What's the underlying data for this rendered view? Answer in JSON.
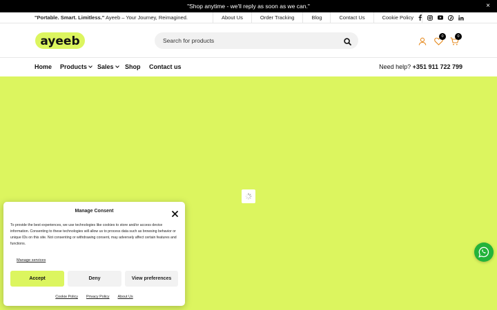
{
  "announcement": {
    "text": "\"Shop anytime - we'll reply as soon as we can.\"",
    "close_glyph": "×"
  },
  "utility": {
    "tagline_bold": "\"Portable. Smart. Limitless.\"",
    "tagline_rest": " Ayeeb – Your Journey, Reimagined.",
    "links": [
      "About Us",
      "Order Tracking",
      "Blog",
      "Contact Us",
      "Cookie Policy"
    ],
    "social_icons": [
      "facebook-icon",
      "instagram-icon",
      "youtube-icon",
      "pinterest-icon",
      "linkedin-icon"
    ]
  },
  "header": {
    "logo_text": "ayeeb",
    "search_placeholder": "Search for products",
    "wishlist_count": "0",
    "cart_count": "0"
  },
  "nav": {
    "items": [
      "Home",
      "Products",
      "Sales",
      "Shop",
      "Contact us"
    ],
    "help_label": "Need help?",
    "help_phone": "+351 911 722 799"
  },
  "colors": {
    "brand_lime": "#dcf55f",
    "whatsapp_green": "#23b33a"
  },
  "consent": {
    "title": "Manage Consent",
    "body": "To provide the best experiences, we use technologies like cookies to store and/or access device information. Consenting to these technologies will allow us to process data such as browsing behavior or unique IDs on this site. Not consenting or withdrawing consent, may adversely affect certain features and functions.",
    "manage_services": "Manage services",
    "accept": "Accept",
    "deny": "Deny",
    "view_preferences": "View preferences",
    "footer_links": [
      "Cookie Policy",
      "Privacy Policy",
      "About Us"
    ]
  }
}
